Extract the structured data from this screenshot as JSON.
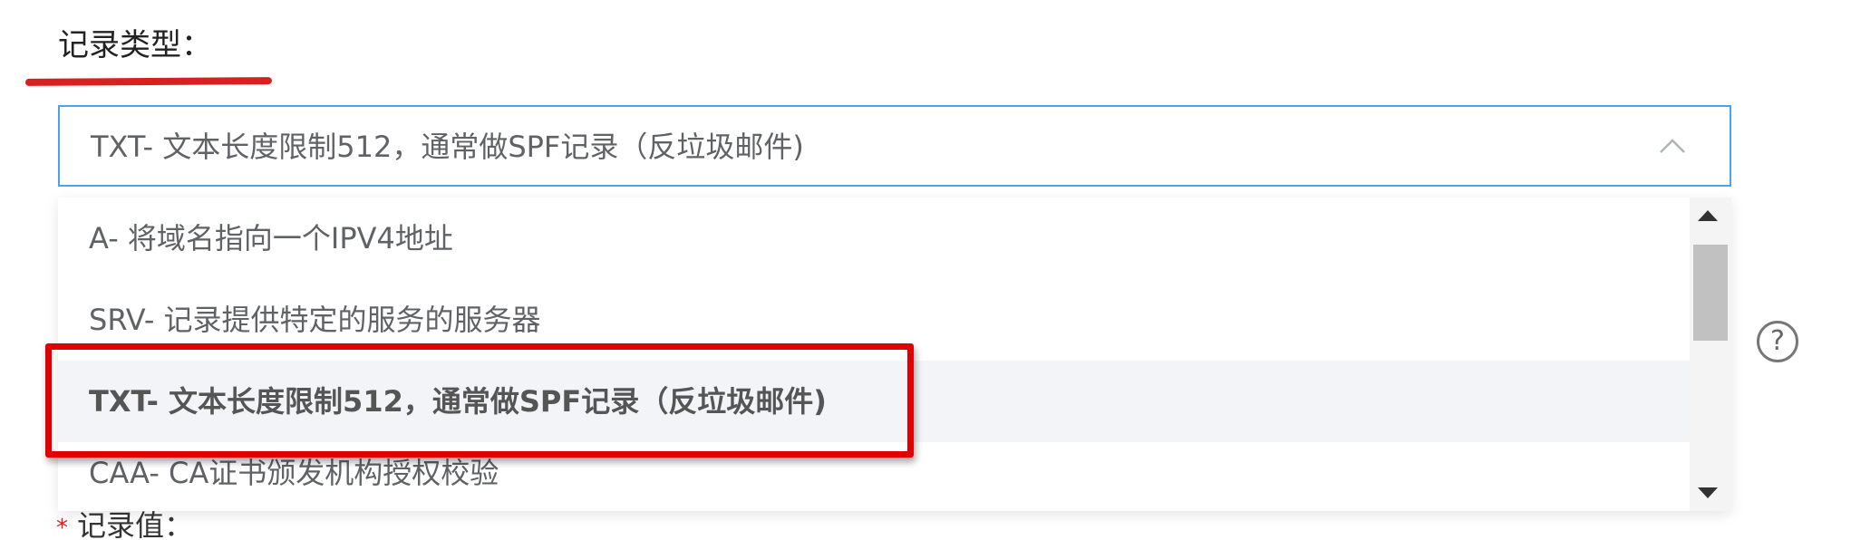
{
  "form": {
    "record_type_label": "记录类型：",
    "selected_value": "TXT- 文本长度限制512，通常做SPF记录（反垃圾邮件)",
    "help_icon_glyph": "?",
    "next_field_label": "记录值：",
    "required_mark": "*"
  },
  "dropdown": {
    "options": [
      {
        "label": "A- 将域名指向一个IPV4地址",
        "selected": false
      },
      {
        "label": "SRV- 记录提供特定的服务的服务器",
        "selected": false
      },
      {
        "label": "TXT- 文本长度限制512，通常做SPF记录（反垃圾邮件)",
        "selected": true
      },
      {
        "label": "CAA- CA证书颁发机构授权校验",
        "selected": false
      }
    ]
  },
  "colors": {
    "focus_border": "#4aa3f0",
    "annotation_red": "#e00000",
    "selected_bg": "#f3f4f7"
  },
  "icons": {
    "select_arrow": "chevron-up-icon",
    "help": "question-circle-icon",
    "scroll_up": "triangle-up-icon",
    "scroll_down": "triangle-down-icon"
  }
}
